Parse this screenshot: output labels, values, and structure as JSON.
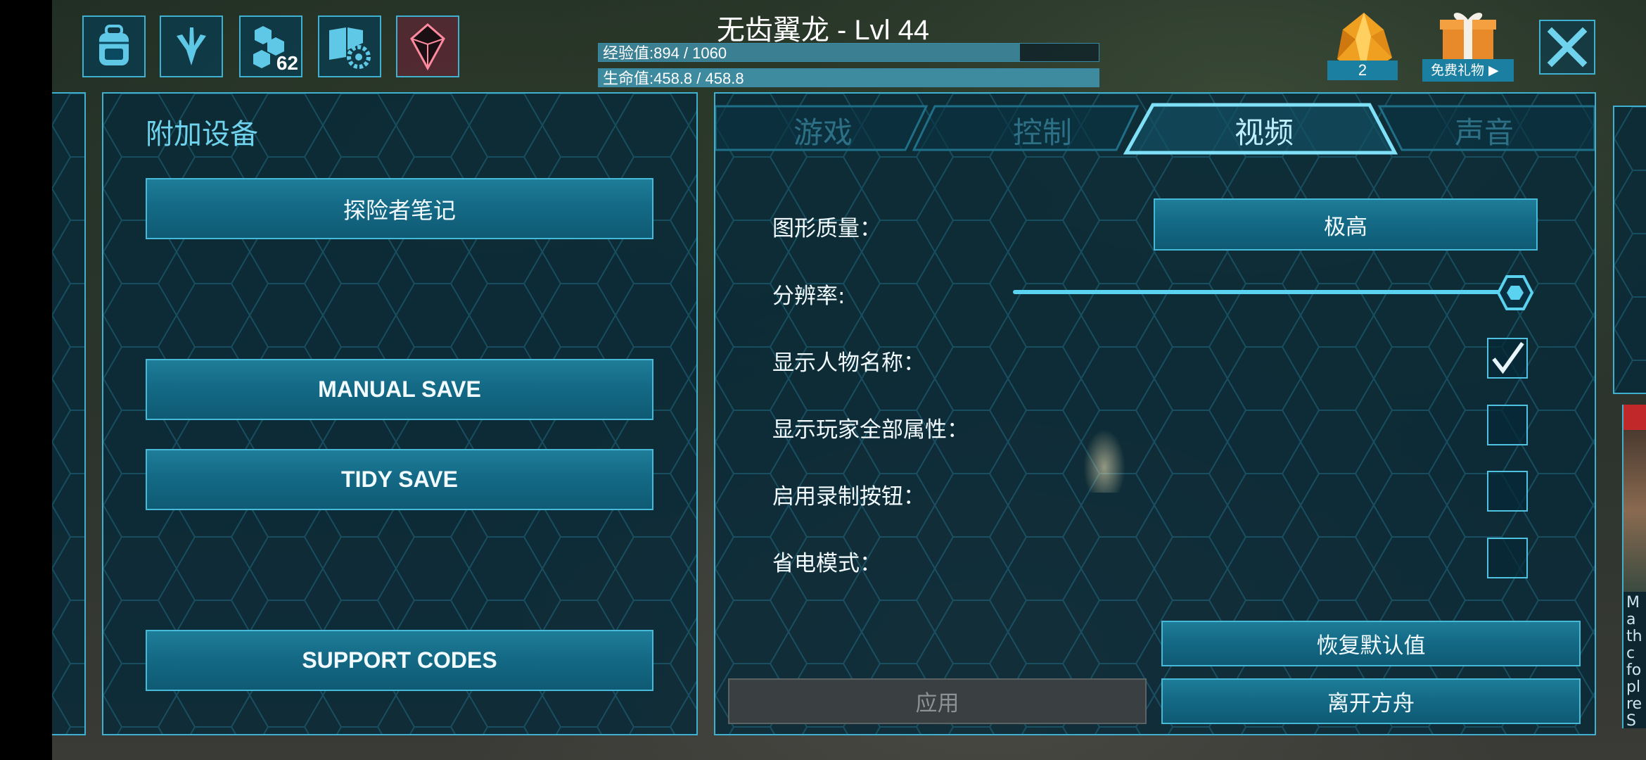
{
  "hud": {
    "creature_title": "无齿翼龙 - Lvl 44",
    "xp_label": "经验值:894 / 1060",
    "xp_fraction": 0.843,
    "hp_label": "生命值:458.8 / 458.8",
    "hp_fraction": 1.0,
    "engram_count": "62",
    "crystal_count": "2",
    "gift_label": "免费礼物 ▶",
    "icons": [
      "backpack-icon",
      "dino-footprint-icon",
      "engram-hex-icon",
      "settings-book-icon",
      "tek-crystal-icon"
    ]
  },
  "left_panel": {
    "title": "附加设备",
    "buttons": {
      "explorer_notes": "探险者笔记",
      "manual_save": "MANUAL SAVE",
      "tidy_save": "TIDY SAVE",
      "support_codes": "SUPPORT CODES"
    }
  },
  "tabs": [
    "游戏",
    "控制",
    "视频",
    "声音"
  ],
  "active_tab": "视频",
  "video": {
    "graphics_quality_label": "图形质量：",
    "graphics_quality_value": "极高",
    "resolution_label": "分辨率:",
    "resolution_value": 1.0,
    "show_names_label": "显示人物名称：",
    "show_names_checked": true,
    "show_all_stats_label": "显示玩家全部属性：",
    "show_all_stats_checked": false,
    "record_button_label": "启用录制按钮：",
    "record_button_checked": false,
    "power_save_label": "省电模式：",
    "power_save_checked": false
  },
  "footer": {
    "restore_defaults": "恢复默认值",
    "apply": "应用",
    "leave_ark": "离开方舟"
  },
  "edge_card_text": "M\na\nth\nc\nfo\npl\nre\nS",
  "colors": {
    "accent": "#3fb0d0",
    "button": "#146a86",
    "panel": "#082a38",
    "title": "#6fd3ee"
  }
}
